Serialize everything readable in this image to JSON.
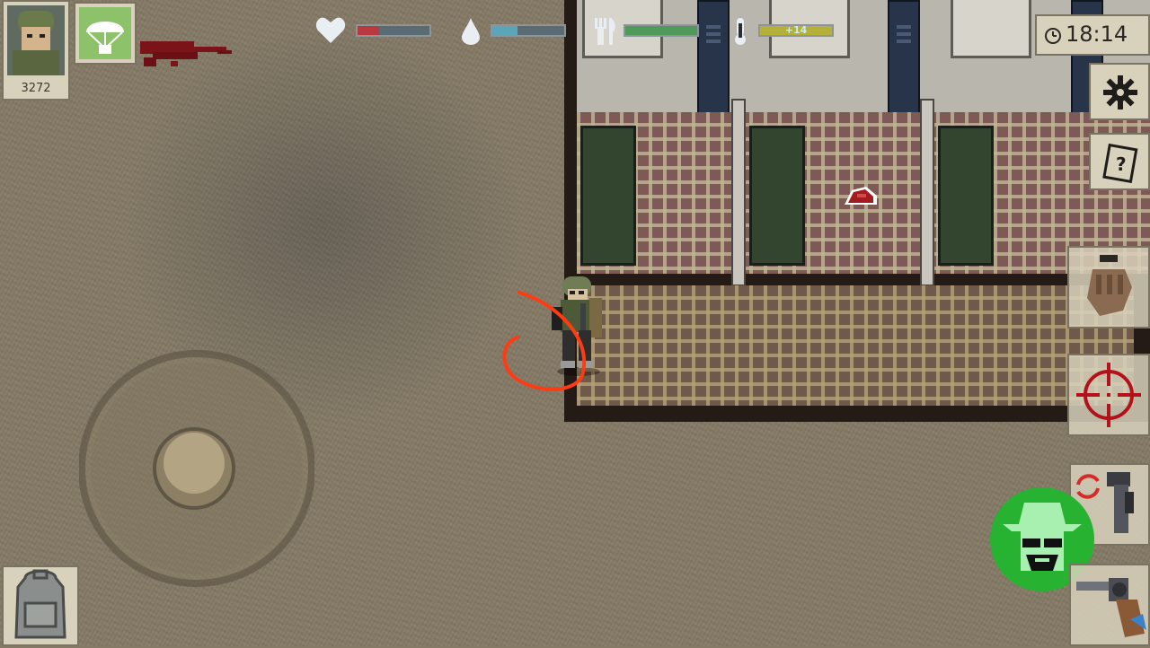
{
  "hud": {
    "score": "3272",
    "temperature_label": "+14",
    "clock_time": "18:14"
  },
  "stats": {
    "health": 0.3,
    "thirst": 0.35,
    "hunger": 1.0,
    "temperature": 1.0
  },
  "colors": {
    "health": "#b83a3e",
    "thirst": "#5aa6b8",
    "hunger": "#4f9a5a",
    "temperature": "#b4b03a",
    "annotation": "#ff3b14",
    "stealth": "#27b331"
  },
  "icons": [
    "heart-icon",
    "water-drop-icon",
    "fork-knife-icon",
    "thermometer-icon",
    "clock-icon",
    "settings-icon",
    "notes-icon",
    "grab-hand-icon",
    "crosshair-icon",
    "backpack-icon",
    "swap-weapon-icon",
    "revolver-icon",
    "stealth-cowboy-icon",
    "parachute-icon"
  ]
}
